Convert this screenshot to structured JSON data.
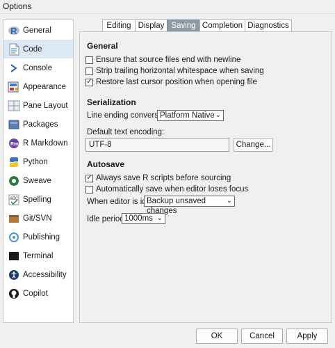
{
  "window": {
    "title": "Options"
  },
  "sidebar": {
    "items": [
      {
        "label": "General",
        "icon": "r-logo-icon",
        "selected": false
      },
      {
        "label": "Code",
        "icon": "code-icon",
        "selected": true
      },
      {
        "label": "Console",
        "icon": "console-prompt-icon",
        "selected": false
      },
      {
        "label": "Appearance",
        "icon": "appearance-icon",
        "selected": false
      },
      {
        "label": "Pane Layout",
        "icon": "pane-layout-icon",
        "selected": false
      },
      {
        "label": "Packages",
        "icon": "packages-icon",
        "selected": false
      },
      {
        "label": "R Markdown",
        "icon": "rmarkdown-icon",
        "selected": false
      },
      {
        "label": "Python",
        "icon": "python-icon",
        "selected": false
      },
      {
        "label": "Sweave",
        "icon": "sweave-icon",
        "selected": false
      },
      {
        "label": "Spelling",
        "icon": "spelling-icon",
        "selected": false
      },
      {
        "label": "Git/SVN",
        "icon": "git-svn-icon",
        "selected": false
      },
      {
        "label": "Publishing",
        "icon": "publishing-icon",
        "selected": false
      },
      {
        "label": "Terminal",
        "icon": "terminal-icon",
        "selected": false
      },
      {
        "label": "Accessibility",
        "icon": "accessibility-icon",
        "selected": false
      },
      {
        "label": "Copilot",
        "icon": "github-icon",
        "selected": false
      }
    ]
  },
  "tabs": [
    {
      "label": "Editing",
      "active": false
    },
    {
      "label": "Display",
      "active": false
    },
    {
      "label": "Saving",
      "active": true
    },
    {
      "label": "Completion",
      "active": false
    },
    {
      "label": "Diagnostics",
      "active": false
    }
  ],
  "general": {
    "heading": "General",
    "newline": {
      "label": "Ensure that source files end with newline",
      "checked": false
    },
    "whitespace": {
      "label": "Strip trailing horizontal whitespace when saving",
      "checked": false
    },
    "restore_cursor": {
      "label": "Restore last cursor position when opening file",
      "checked": true
    }
  },
  "serialization": {
    "heading": "Serialization",
    "line_ending_label": "Line ending conversion:",
    "line_ending_value": "Platform Native",
    "encoding_label": "Default text encoding:",
    "encoding_value": "UTF-8",
    "change_button": "Change..."
  },
  "autosave": {
    "heading": "Autosave",
    "always_save": {
      "label": "Always save R scripts before sourcing",
      "checked": true
    },
    "auto_save_focus": {
      "label": "Automatically save when editor loses focus",
      "checked": false
    },
    "idle_label": "When editor is idle:",
    "idle_value": "Backup unsaved changes",
    "idle_period_label": "Idle period:",
    "idle_period_value": "1000ms"
  },
  "footer": {
    "ok": "OK",
    "cancel": "Cancel",
    "apply": "Apply"
  },
  "colors": {
    "selected_sidebar": "#dde8f5",
    "active_tab": "#8f9aa6"
  }
}
